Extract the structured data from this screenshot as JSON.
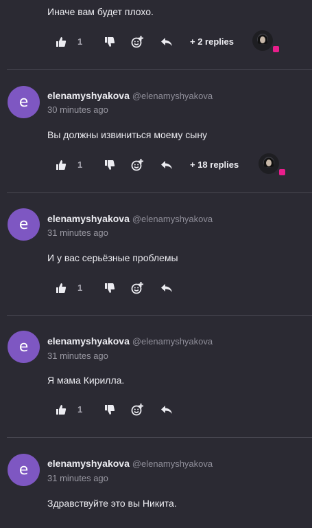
{
  "comments": [
    {
      "author": "",
      "handle": "",
      "time": "",
      "text": "Иначе вам будет плохо.",
      "likes": "1",
      "replies": "+ 2 replies"
    },
    {
      "avatar_letter": "e",
      "author": "elenamyshyakova",
      "handle": "@elenamyshyakova",
      "time": "30 minutes ago",
      "text": "Вы должны извиниться моему сыну",
      "likes": "1",
      "replies": "+ 18 replies"
    },
    {
      "avatar_letter": "e",
      "author": "elenamyshyakova",
      "handle": "@elenamyshyakova",
      "time": "31 minutes ago",
      "text": "И у вас серьёзные проблемы",
      "likes": "1"
    },
    {
      "avatar_letter": "e",
      "author": "elenamyshyakova",
      "handle": "@elenamyshyakova",
      "time": "31 minutes ago",
      "text": "Я мама Кирилла.",
      "likes": "1"
    },
    {
      "avatar_letter": "e",
      "author": "elenamyshyakova",
      "handle": "@elenamyshyakova",
      "time": "31 minutes ago",
      "text": "Здравствуйте это вы Никита."
    }
  ],
  "colors": {
    "background": "#2b2a33",
    "avatar": "#7e57c2",
    "badge": "#e91e8c"
  },
  "icons": [
    "thumb-up-icon",
    "thumb-down-icon",
    "add-emoji-icon",
    "reply-icon"
  ]
}
